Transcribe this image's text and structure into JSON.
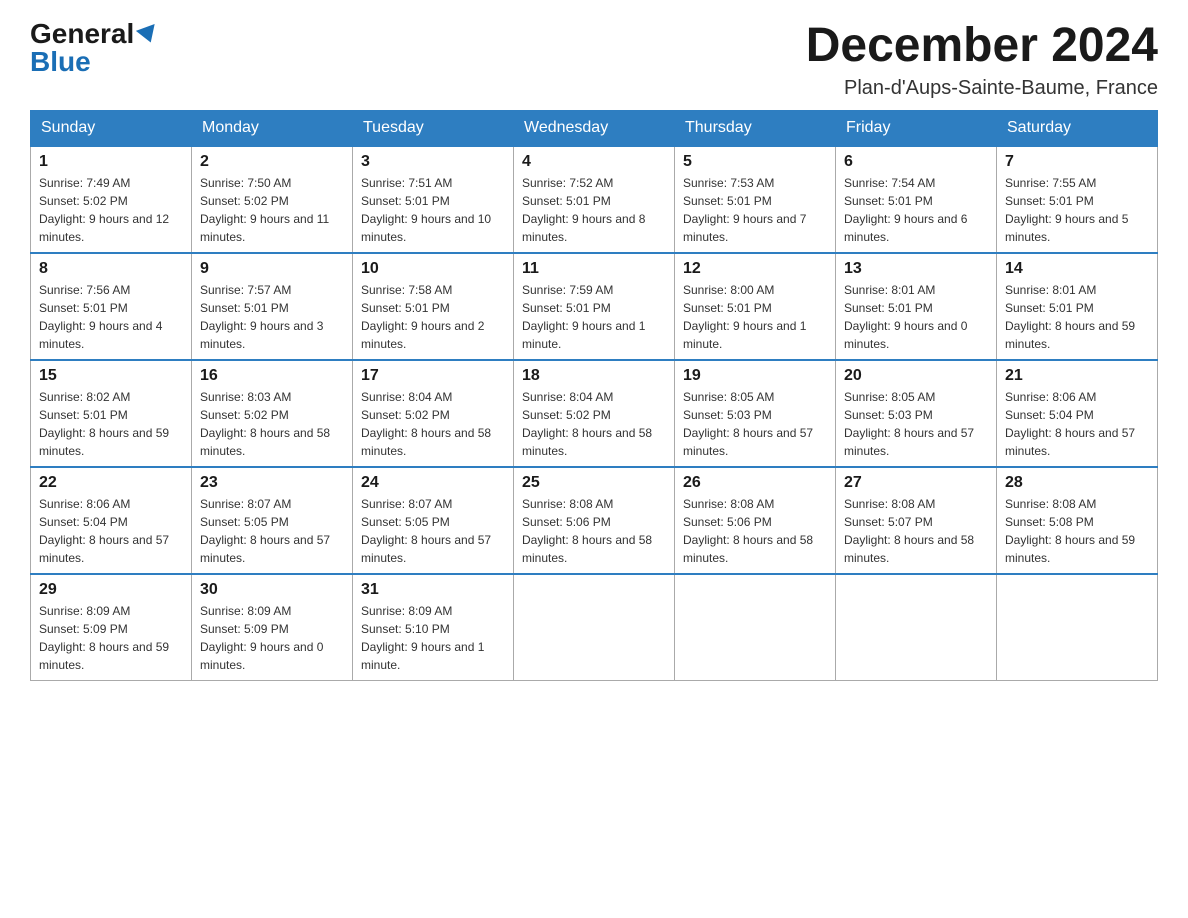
{
  "header": {
    "logo_general": "General",
    "logo_blue": "Blue",
    "month_title": "December 2024",
    "location": "Plan-d'Aups-Sainte-Baume, France"
  },
  "days_of_week": [
    "Sunday",
    "Monday",
    "Tuesday",
    "Wednesday",
    "Thursday",
    "Friday",
    "Saturday"
  ],
  "weeks": [
    [
      {
        "day": "1",
        "sunrise": "7:49 AM",
        "sunset": "5:02 PM",
        "daylight": "9 hours and 12 minutes."
      },
      {
        "day": "2",
        "sunrise": "7:50 AM",
        "sunset": "5:02 PM",
        "daylight": "9 hours and 11 minutes."
      },
      {
        "day": "3",
        "sunrise": "7:51 AM",
        "sunset": "5:01 PM",
        "daylight": "9 hours and 10 minutes."
      },
      {
        "day": "4",
        "sunrise": "7:52 AM",
        "sunset": "5:01 PM",
        "daylight": "9 hours and 8 minutes."
      },
      {
        "day": "5",
        "sunrise": "7:53 AM",
        "sunset": "5:01 PM",
        "daylight": "9 hours and 7 minutes."
      },
      {
        "day": "6",
        "sunrise": "7:54 AM",
        "sunset": "5:01 PM",
        "daylight": "9 hours and 6 minutes."
      },
      {
        "day": "7",
        "sunrise": "7:55 AM",
        "sunset": "5:01 PM",
        "daylight": "9 hours and 5 minutes."
      }
    ],
    [
      {
        "day": "8",
        "sunrise": "7:56 AM",
        "sunset": "5:01 PM",
        "daylight": "9 hours and 4 minutes."
      },
      {
        "day": "9",
        "sunrise": "7:57 AM",
        "sunset": "5:01 PM",
        "daylight": "9 hours and 3 minutes."
      },
      {
        "day": "10",
        "sunrise": "7:58 AM",
        "sunset": "5:01 PM",
        "daylight": "9 hours and 2 minutes."
      },
      {
        "day": "11",
        "sunrise": "7:59 AM",
        "sunset": "5:01 PM",
        "daylight": "9 hours and 1 minute."
      },
      {
        "day": "12",
        "sunrise": "8:00 AM",
        "sunset": "5:01 PM",
        "daylight": "9 hours and 1 minute."
      },
      {
        "day": "13",
        "sunrise": "8:01 AM",
        "sunset": "5:01 PM",
        "daylight": "9 hours and 0 minutes."
      },
      {
        "day": "14",
        "sunrise": "8:01 AM",
        "sunset": "5:01 PM",
        "daylight": "8 hours and 59 minutes."
      }
    ],
    [
      {
        "day": "15",
        "sunrise": "8:02 AM",
        "sunset": "5:01 PM",
        "daylight": "8 hours and 59 minutes."
      },
      {
        "day": "16",
        "sunrise": "8:03 AM",
        "sunset": "5:02 PM",
        "daylight": "8 hours and 58 minutes."
      },
      {
        "day": "17",
        "sunrise": "8:04 AM",
        "sunset": "5:02 PM",
        "daylight": "8 hours and 58 minutes."
      },
      {
        "day": "18",
        "sunrise": "8:04 AM",
        "sunset": "5:02 PM",
        "daylight": "8 hours and 58 minutes."
      },
      {
        "day": "19",
        "sunrise": "8:05 AM",
        "sunset": "5:03 PM",
        "daylight": "8 hours and 57 minutes."
      },
      {
        "day": "20",
        "sunrise": "8:05 AM",
        "sunset": "5:03 PM",
        "daylight": "8 hours and 57 minutes."
      },
      {
        "day": "21",
        "sunrise": "8:06 AM",
        "sunset": "5:04 PM",
        "daylight": "8 hours and 57 minutes."
      }
    ],
    [
      {
        "day": "22",
        "sunrise": "8:06 AM",
        "sunset": "5:04 PM",
        "daylight": "8 hours and 57 minutes."
      },
      {
        "day": "23",
        "sunrise": "8:07 AM",
        "sunset": "5:05 PM",
        "daylight": "8 hours and 57 minutes."
      },
      {
        "day": "24",
        "sunrise": "8:07 AM",
        "sunset": "5:05 PM",
        "daylight": "8 hours and 57 minutes."
      },
      {
        "day": "25",
        "sunrise": "8:08 AM",
        "sunset": "5:06 PM",
        "daylight": "8 hours and 58 minutes."
      },
      {
        "day": "26",
        "sunrise": "8:08 AM",
        "sunset": "5:06 PM",
        "daylight": "8 hours and 58 minutes."
      },
      {
        "day": "27",
        "sunrise": "8:08 AM",
        "sunset": "5:07 PM",
        "daylight": "8 hours and 58 minutes."
      },
      {
        "day": "28",
        "sunrise": "8:08 AM",
        "sunset": "5:08 PM",
        "daylight": "8 hours and 59 minutes."
      }
    ],
    [
      {
        "day": "29",
        "sunrise": "8:09 AM",
        "sunset": "5:09 PM",
        "daylight": "8 hours and 59 minutes."
      },
      {
        "day": "30",
        "sunrise": "8:09 AM",
        "sunset": "5:09 PM",
        "daylight": "9 hours and 0 minutes."
      },
      {
        "day": "31",
        "sunrise": "8:09 AM",
        "sunset": "5:10 PM",
        "daylight": "9 hours and 1 minute."
      },
      null,
      null,
      null,
      null
    ]
  ]
}
